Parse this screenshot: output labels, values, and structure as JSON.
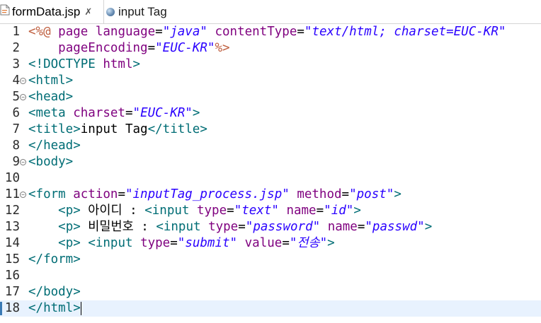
{
  "tabs": [
    {
      "label": "formData.jsp",
      "close": "✗",
      "active": true,
      "icon": "jsp-file-icon"
    },
    {
      "label": "input Tag",
      "active": false,
      "icon": "globe-icon"
    }
  ],
  "editor": {
    "current_line": 18,
    "lines": [
      {
        "n": "1",
        "fold": false,
        "tokens": [
          [
            "dir",
            "<%@"
          ],
          [
            "txt",
            " "
          ],
          [
            "attr",
            "page"
          ],
          [
            "txt",
            " "
          ],
          [
            "attr",
            "language"
          ],
          [
            "txt",
            "="
          ],
          [
            "val",
            "\"java\""
          ],
          [
            "txt",
            " "
          ],
          [
            "attr",
            "contentType"
          ],
          [
            "txt",
            "="
          ],
          [
            "val",
            "\"text/html; charset=EUC-KR\""
          ]
        ]
      },
      {
        "n": "2",
        "fold": false,
        "tokens": [
          [
            "txt",
            "    "
          ],
          [
            "attr",
            "pageEncoding"
          ],
          [
            "txt",
            "="
          ],
          [
            "val",
            "\"EUC-KR\""
          ],
          [
            "dir",
            "%>"
          ]
        ]
      },
      {
        "n": "3",
        "fold": false,
        "tokens": [
          [
            "tag",
            "<!DOCTYPE "
          ],
          [
            "attr",
            "html"
          ],
          [
            "tag",
            ">"
          ]
        ]
      },
      {
        "n": "4",
        "fold": true,
        "tokens": [
          [
            "tag",
            "<html>"
          ]
        ]
      },
      {
        "n": "5",
        "fold": true,
        "tokens": [
          [
            "tag",
            "<head>"
          ]
        ]
      },
      {
        "n": "6",
        "fold": false,
        "tokens": [
          [
            "tag",
            "<meta "
          ],
          [
            "attr",
            "charset"
          ],
          [
            "txt",
            "="
          ],
          [
            "val",
            "\"EUC-KR\""
          ],
          [
            "tag",
            ">"
          ]
        ]
      },
      {
        "n": "7",
        "fold": false,
        "tokens": [
          [
            "tag",
            "<title>"
          ],
          [
            "txt",
            "input Tag"
          ],
          [
            "tag",
            "</title>"
          ]
        ]
      },
      {
        "n": "8",
        "fold": false,
        "tokens": [
          [
            "tag",
            "</head>"
          ]
        ]
      },
      {
        "n": "9",
        "fold": true,
        "tokens": [
          [
            "tag",
            "<body>"
          ]
        ]
      },
      {
        "n": "10",
        "fold": false,
        "tokens": []
      },
      {
        "n": "11",
        "fold": true,
        "tokens": [
          [
            "tag",
            "<form "
          ],
          [
            "attr",
            "action"
          ],
          [
            "txt",
            "="
          ],
          [
            "val",
            "\"inputTag_process.jsp\""
          ],
          [
            "txt",
            " "
          ],
          [
            "attr",
            "method"
          ],
          [
            "txt",
            "="
          ],
          [
            "val",
            "\"post\""
          ],
          [
            "tag",
            ">"
          ]
        ]
      },
      {
        "n": "12",
        "fold": false,
        "tokens": [
          [
            "txt",
            "    "
          ],
          [
            "tag",
            "<p>"
          ],
          [
            "txt",
            " 아이디 : "
          ],
          [
            "tag",
            "<input "
          ],
          [
            "attr",
            "type"
          ],
          [
            "txt",
            "="
          ],
          [
            "val",
            "\"text\""
          ],
          [
            "txt",
            " "
          ],
          [
            "attr",
            "name"
          ],
          [
            "txt",
            "="
          ],
          [
            "val",
            "\"id\""
          ],
          [
            "tag",
            ">"
          ]
        ]
      },
      {
        "n": "13",
        "fold": false,
        "tokens": [
          [
            "txt",
            "    "
          ],
          [
            "tag",
            "<p>"
          ],
          [
            "txt",
            " 비밀번호 : "
          ],
          [
            "tag",
            "<input "
          ],
          [
            "attr",
            "type"
          ],
          [
            "txt",
            "="
          ],
          [
            "val",
            "\"password\""
          ],
          [
            "txt",
            " "
          ],
          [
            "attr",
            "name"
          ],
          [
            "txt",
            "="
          ],
          [
            "val",
            "\"passwd\""
          ],
          [
            "tag",
            ">"
          ]
        ]
      },
      {
        "n": "14",
        "fold": false,
        "tokens": [
          [
            "txt",
            "    "
          ],
          [
            "tag",
            "<p>"
          ],
          [
            "txt",
            " "
          ],
          [
            "tag",
            "<input "
          ],
          [
            "attr",
            "type"
          ],
          [
            "txt",
            "="
          ],
          [
            "val",
            "\"submit\""
          ],
          [
            "txt",
            " "
          ],
          [
            "attr",
            "value"
          ],
          [
            "txt",
            "="
          ],
          [
            "val",
            "\"전송\""
          ],
          [
            "tag",
            ">"
          ]
        ]
      },
      {
        "n": "15",
        "fold": false,
        "tokens": [
          [
            "tag",
            "</form>"
          ]
        ]
      },
      {
        "n": "16",
        "fold": false,
        "tokens": []
      },
      {
        "n": "17",
        "fold": false,
        "tokens": [
          [
            "tag",
            "</body>"
          ]
        ]
      },
      {
        "n": "18",
        "fold": false,
        "tokens": [
          [
            "tag",
            "</html>"
          ]
        ]
      }
    ]
  }
}
